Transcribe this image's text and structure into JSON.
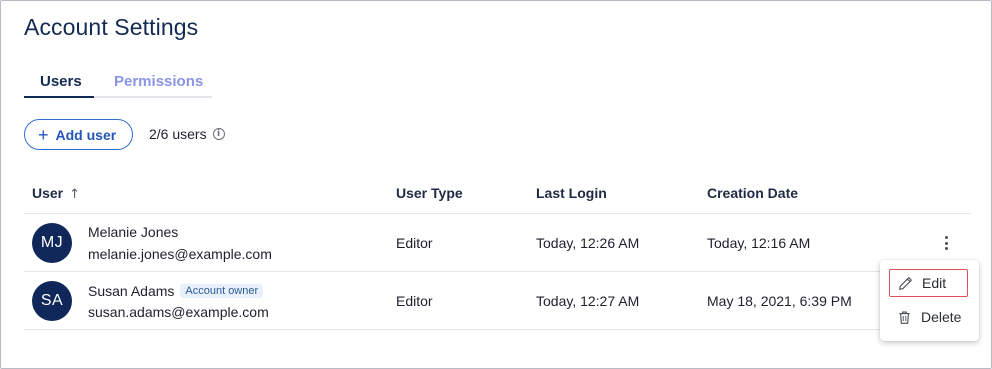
{
  "page": {
    "title": "Account Settings"
  },
  "tabs": [
    {
      "label": "Users",
      "active": true
    },
    {
      "label": "Permissions",
      "active": false
    }
  ],
  "toolbar": {
    "add_user_label": "Add user",
    "add_user_icon": "plus-icon",
    "user_count": "2/6 users",
    "info_icon": "info-icon"
  },
  "table": {
    "headers": [
      "User",
      "User Type",
      "Last Login",
      "Creation Date"
    ],
    "sort_icon": "arrow-up-icon",
    "rows": [
      {
        "initials": "MJ",
        "name": "Melanie Jones",
        "badge": "",
        "email": "melanie.jones@example.com",
        "user_type": "Editor",
        "last_login": "Today, 12:26 AM",
        "creation_date": "Today, 12:16 AM"
      },
      {
        "initials": "SA",
        "name": "Susan Adams",
        "badge": "Account owner",
        "email": "susan.adams@example.com",
        "user_type": "Editor",
        "last_login": "Today, 12:27 AM",
        "creation_date": "May 18, 2021, 6:39 PM"
      }
    ]
  },
  "row_menu": {
    "icon": "more-vertical-icon",
    "items": [
      {
        "label": "Edit",
        "icon": "pencil-icon"
      },
      {
        "label": "Delete",
        "icon": "trash-icon"
      }
    ]
  },
  "colors": {
    "primary": "#132a52",
    "accent": "#2f6fd1",
    "avatar_bg": "#10275a",
    "inactive_tab": "#8a95e6",
    "focus_outline": "#e0505a"
  }
}
